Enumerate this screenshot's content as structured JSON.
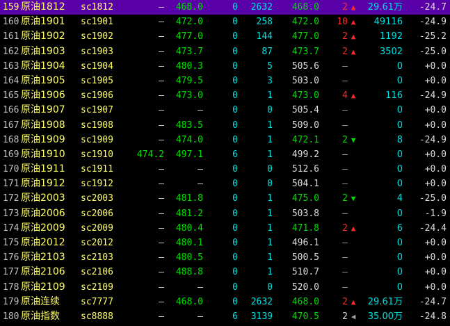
{
  "colors": {
    "selected_row": "#5a00a8",
    "up": "#ff2a2a",
    "down": "#00e000",
    "volume": "#00e0e0",
    "neutral": "#dddddd",
    "name": "#ffff66"
  },
  "rows": [
    {
      "num": "159",
      "name": "原油1812",
      "code": "sc1812",
      "bid": "–",
      "ask": "468.0",
      "bid_vol": "0",
      "ask_vol": "2632",
      "last": "468.0",
      "last_vol": "2",
      "arrow": "up",
      "volume": "29.61万",
      "change": "-24.7",
      "selected": true
    },
    {
      "num": "160",
      "name": "原油1901",
      "code": "sc1901",
      "bid": "–",
      "ask": "472.0",
      "bid_vol": "0",
      "ask_vol": "258",
      "last": "472.0",
      "last_vol": "10",
      "arrow": "up",
      "volume": "49116",
      "change": "-24.9",
      "selected": false
    },
    {
      "num": "161",
      "name": "原油1902",
      "code": "sc1902",
      "bid": "–",
      "ask": "477.0",
      "bid_vol": "0",
      "ask_vol": "144",
      "last": "477.0",
      "last_vol": "2",
      "arrow": "up",
      "volume": "1192",
      "change": "-25.2",
      "selected": false
    },
    {
      "num": "162",
      "name": "原油1903",
      "code": "sc1903",
      "bid": "–",
      "ask": "473.7",
      "bid_vol": "0",
      "ask_vol": "87",
      "last": "473.7",
      "last_vol": "2",
      "arrow": "up",
      "volume": "3502",
      "change": "-25.0",
      "selected": false
    },
    {
      "num": "163",
      "name": "原油1904",
      "code": "sc1904",
      "bid": "–",
      "ask": "480.3",
      "bid_vol": "0",
      "ask_vol": "5",
      "last": "505.6",
      "last_vol": "–",
      "arrow": "",
      "volume": "0",
      "change": "+0.0",
      "selected": false
    },
    {
      "num": "164",
      "name": "原油1905",
      "code": "sc1905",
      "bid": "–",
      "ask": "479.5",
      "bid_vol": "0",
      "ask_vol": "3",
      "last": "503.0",
      "last_vol": "–",
      "arrow": "",
      "volume": "0",
      "change": "+0.0",
      "selected": false
    },
    {
      "num": "165",
      "name": "原油1906",
      "code": "sc1906",
      "bid": "–",
      "ask": "473.0",
      "bid_vol": "0",
      "ask_vol": "1",
      "last": "473.0",
      "last_vol": "4",
      "arrow": "up",
      "volume": "116",
      "change": "-24.9",
      "selected": false
    },
    {
      "num": "166",
      "name": "原油1907",
      "code": "sc1907",
      "bid": "–",
      "ask": "–",
      "bid_vol": "0",
      "ask_vol": "0",
      "last": "505.4",
      "last_vol": "–",
      "arrow": "",
      "volume": "0",
      "change": "+0.0",
      "selected": false
    },
    {
      "num": "167",
      "name": "原油1908",
      "code": "sc1908",
      "bid": "–",
      "ask": "483.5",
      "bid_vol": "0",
      "ask_vol": "1",
      "last": "509.0",
      "last_vol": "–",
      "arrow": "",
      "volume": "0",
      "change": "+0.0",
      "selected": false
    },
    {
      "num": "168",
      "name": "原油1909",
      "code": "sc1909",
      "bid": "–",
      "ask": "474.0",
      "bid_vol": "0",
      "ask_vol": "1",
      "last": "472.1",
      "last_vol": "2",
      "arrow": "down",
      "volume": "8",
      "change": "-24.9",
      "selected": false
    },
    {
      "num": "169",
      "name": "原油1910",
      "code": "sc1910",
      "bid": "474.2",
      "ask": "497.1",
      "bid_vol": "6",
      "ask_vol": "1",
      "last": "499.2",
      "last_vol": "–",
      "arrow": "",
      "volume": "0",
      "change": "+0.0",
      "selected": false
    },
    {
      "num": "170",
      "name": "原油1911",
      "code": "sc1911",
      "bid": "–",
      "ask": "–",
      "bid_vol": "0",
      "ask_vol": "0",
      "last": "512.6",
      "last_vol": "–",
      "arrow": "",
      "volume": "0",
      "change": "+0.0",
      "selected": false
    },
    {
      "num": "171",
      "name": "原油1912",
      "code": "sc1912",
      "bid": "–",
      "ask": "–",
      "bid_vol": "0",
      "ask_vol": "0",
      "last": "504.1",
      "last_vol": "–",
      "arrow": "",
      "volume": "0",
      "change": "+0.0",
      "selected": false
    },
    {
      "num": "172",
      "name": "原油2003",
      "code": "sc2003",
      "bid": "–",
      "ask": "481.8",
      "bid_vol": "0",
      "ask_vol": "1",
      "last": "475.0",
      "last_vol": "2",
      "arrow": "down",
      "volume": "4",
      "change": "-25.0",
      "selected": false
    },
    {
      "num": "173",
      "name": "原油2006",
      "code": "sc2006",
      "bid": "–",
      "ask": "481.2",
      "bid_vol": "0",
      "ask_vol": "1",
      "last": "503.8",
      "last_vol": "–",
      "arrow": "",
      "volume": "0",
      "change": "-1.9",
      "selected": false
    },
    {
      "num": "174",
      "name": "原油2009",
      "code": "sc2009",
      "bid": "–",
      "ask": "480.4",
      "bid_vol": "0",
      "ask_vol": "1",
      "last": "471.8",
      "last_vol": "2",
      "arrow": "up",
      "volume": "6",
      "change": "-24.4",
      "selected": false
    },
    {
      "num": "175",
      "name": "原油2012",
      "code": "sc2012",
      "bid": "–",
      "ask": "480.1",
      "bid_vol": "0",
      "ask_vol": "1",
      "last": "496.1",
      "last_vol": "–",
      "arrow": "",
      "volume": "0",
      "change": "+0.0",
      "selected": false
    },
    {
      "num": "176",
      "name": "原油2103",
      "code": "sc2103",
      "bid": "–",
      "ask": "480.5",
      "bid_vol": "0",
      "ask_vol": "1",
      "last": "500.5",
      "last_vol": "–",
      "arrow": "",
      "volume": "0",
      "change": "+0.0",
      "selected": false
    },
    {
      "num": "177",
      "name": "原油2106",
      "code": "sc2106",
      "bid": "–",
      "ask": "488.8",
      "bid_vol": "0",
      "ask_vol": "1",
      "last": "510.7",
      "last_vol": "–",
      "arrow": "",
      "volume": "0",
      "change": "+0.0",
      "selected": false
    },
    {
      "num": "178",
      "name": "原油2109",
      "code": "sc2109",
      "bid": "–",
      "ask": "–",
      "bid_vol": "0",
      "ask_vol": "0",
      "last": "520.0",
      "last_vol": "–",
      "arrow": "",
      "volume": "0",
      "change": "+0.0",
      "selected": false
    },
    {
      "num": "179",
      "name": "原油连续",
      "code": "sc7777",
      "bid": "–",
      "ask": "468.0",
      "bid_vol": "0",
      "ask_vol": "2632",
      "last": "468.0",
      "last_vol": "2",
      "arrow": "up",
      "volume": "29.61万",
      "change": "-24.7",
      "selected": false
    },
    {
      "num": "180",
      "name": "原油指数",
      "code": "sc8888",
      "bid": "–",
      "ask": "–",
      "bid_vol": "6",
      "ask_vol": "3139",
      "last": "470.5",
      "last_vol": "2",
      "arrow": "left",
      "volume": "35.00万",
      "change": "-24.8",
      "selected": false
    }
  ]
}
